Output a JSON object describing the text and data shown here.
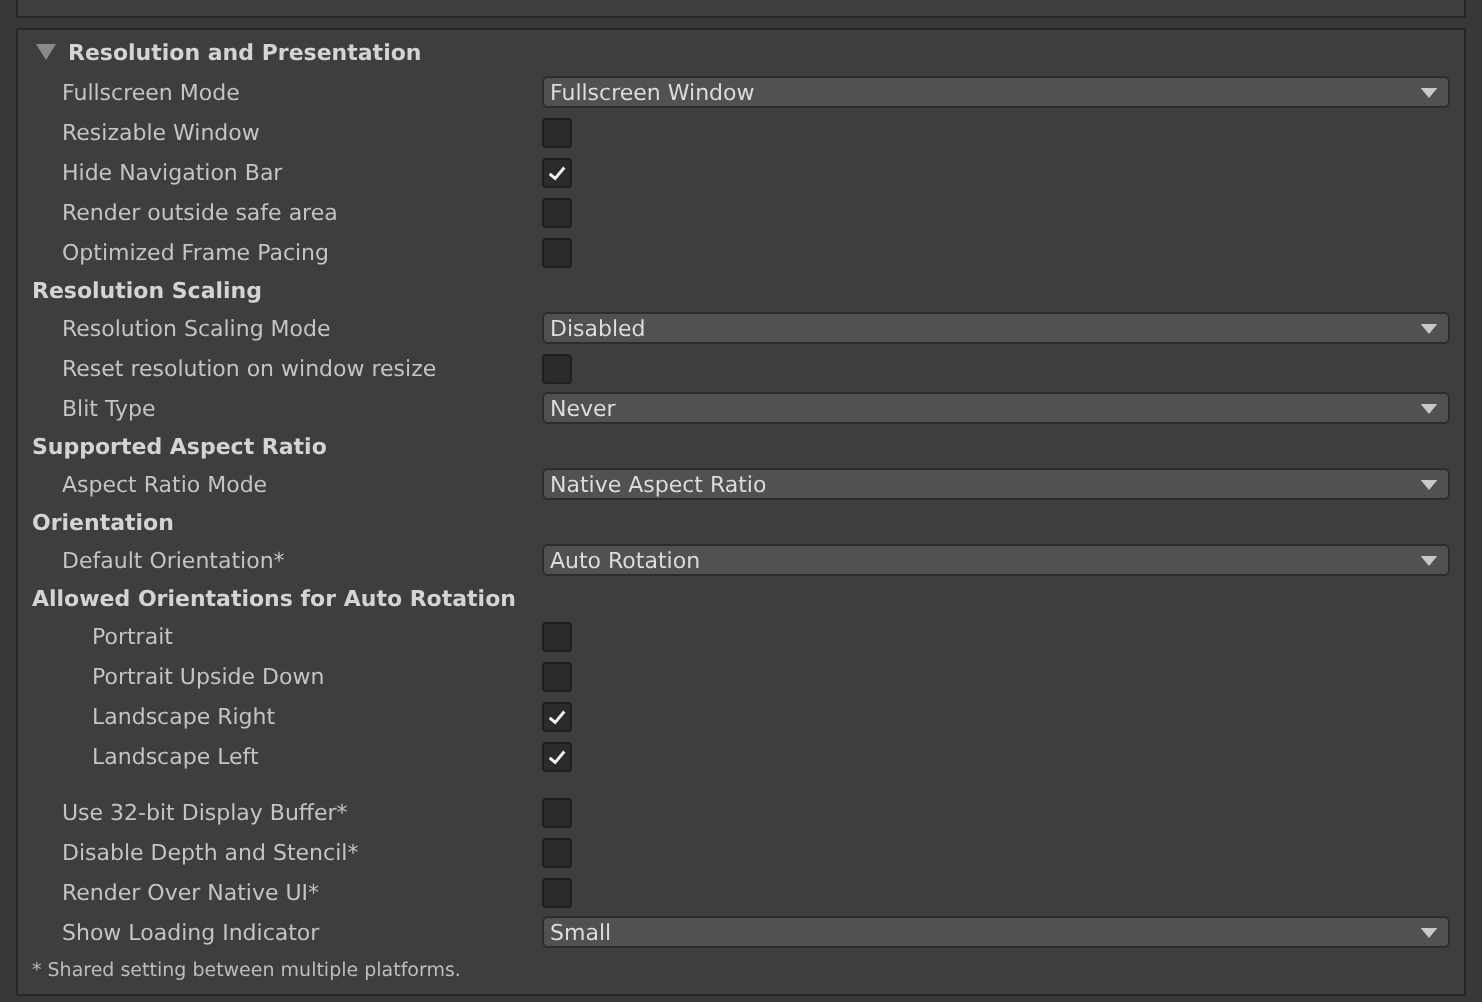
{
  "section": {
    "title": "Resolution and Presentation",
    "expanded": true
  },
  "groups": [
    {
      "kind": "settings",
      "rows": [
        {
          "kind": "dropdown",
          "label": "Fullscreen Mode",
          "value": "Fullscreen Window"
        },
        {
          "kind": "checkbox",
          "label": "Resizable Window",
          "checked": false
        },
        {
          "kind": "checkbox",
          "label": "Hide Navigation Bar",
          "checked": true
        },
        {
          "kind": "checkbox",
          "label": "Render outside safe area",
          "checked": false
        },
        {
          "kind": "checkbox",
          "label": "Optimized Frame Pacing",
          "checked": false
        }
      ]
    },
    {
      "kind": "settings",
      "heading": "Resolution Scaling",
      "rows": [
        {
          "kind": "dropdown",
          "label": "Resolution Scaling Mode",
          "value": "Disabled"
        },
        {
          "kind": "checkbox",
          "label": "Reset resolution on window resize",
          "checked": false
        },
        {
          "kind": "dropdown",
          "label": "Blit Type",
          "value": "Never"
        }
      ]
    },
    {
      "kind": "settings",
      "heading": "Supported Aspect Ratio",
      "rows": [
        {
          "kind": "dropdown",
          "label": "Aspect Ratio Mode",
          "value": "Native Aspect Ratio"
        }
      ]
    },
    {
      "kind": "settings",
      "heading": "Orientation",
      "rows": [
        {
          "kind": "dropdown",
          "label": "Default Orientation*",
          "value": "Auto Rotation"
        }
      ]
    },
    {
      "kind": "checklist",
      "heading": "Allowed Orientations for Auto Rotation",
      "rows": [
        {
          "kind": "checkbox",
          "label": "Portrait",
          "checked": false
        },
        {
          "kind": "checkbox",
          "label": "Portrait Upside Down",
          "checked": false
        },
        {
          "kind": "checkbox",
          "label": "Landscape Right",
          "checked": true
        },
        {
          "kind": "checkbox",
          "label": "Landscape Left",
          "checked": true
        }
      ]
    },
    {
      "kind": "spaced",
      "rows": [
        {
          "kind": "checkbox",
          "label": "Use 32-bit Display Buffer*",
          "checked": false
        },
        {
          "kind": "checkbox",
          "label": "Disable Depth and Stencil*",
          "checked": false
        },
        {
          "kind": "checkbox",
          "label": "Render Over Native UI*",
          "checked": false
        },
        {
          "kind": "dropdown",
          "label": "Show Loading Indicator",
          "value": "Small"
        }
      ]
    }
  ],
  "footnote": "* Shared setting between multiple platforms."
}
